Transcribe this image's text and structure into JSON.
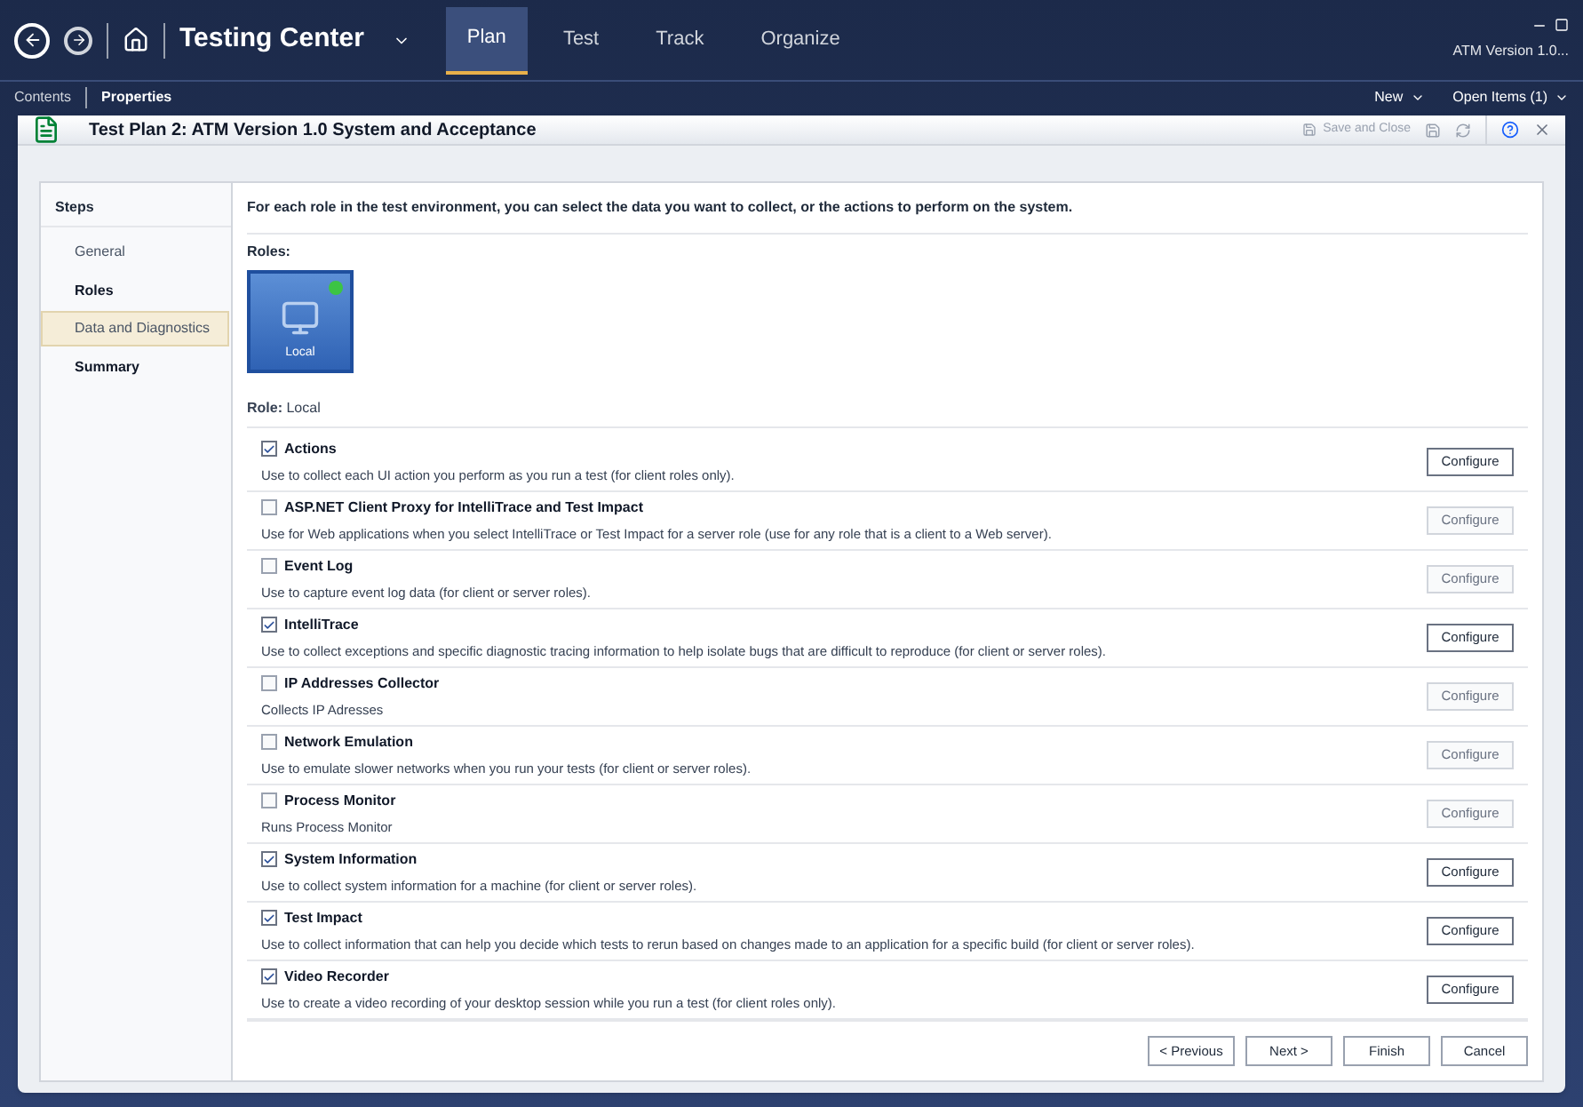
{
  "top_bar": {
    "app_title": "Testing Center",
    "tabs": [
      {
        "label": "Plan",
        "selected": true
      },
      {
        "label": "Test",
        "selected": false
      },
      {
        "label": "Track",
        "selected": false
      },
      {
        "label": "Organize",
        "selected": false
      }
    ],
    "project": "ATM Version 1.0..."
  },
  "sub_bar": {
    "tabs": [
      {
        "label": "Contents",
        "selected": false
      },
      {
        "label": "Properties",
        "selected": true
      }
    ],
    "right_menus": [
      "New",
      "Open Items (1)"
    ]
  },
  "window": {
    "title": "Test Plan 2: ATM Version 1.0 System and Acceptance",
    "save_and_close": {
      "label": "Save and Close",
      "disabled": true
    }
  },
  "steps": {
    "heading": "Steps",
    "items": [
      {
        "label": "General",
        "selected": false,
        "emphasized": false
      },
      {
        "label": "Roles",
        "selected": false,
        "emphasized": true
      },
      {
        "label": "Data and Diagnostics",
        "selected": true,
        "emphasized": false
      },
      {
        "label": "Summary",
        "selected": false,
        "emphasized": true
      }
    ]
  },
  "intro": "For each role in the test environment, you can select the data you want to collect, or the actions to perform on the system.",
  "roles": {
    "heading": "Roles:",
    "items": [
      {
        "label": "Local",
        "selected": true
      }
    ]
  },
  "role": {
    "label": "Role:",
    "value": "Local"
  },
  "adapters": [
    {
      "name": "Actions",
      "description": "Use to collect each UI action you perform as you run a test (for client roles only).",
      "checked": true,
      "button": "Configure",
      "disabled": false
    },
    {
      "name": "ASP.NET Client Proxy for IntelliTrace and Test Impact",
      "description": "Use for Web applications when you select IntelliTrace or Test Impact for a server role (use for any role that is a client to a Web server).",
      "checked": false,
      "button": "Configure",
      "disabled": true
    },
    {
      "name": "Event Log",
      "description": "Use to capture event log data (for client or server roles).",
      "checked": false,
      "button": "Configure",
      "disabled": true
    },
    {
      "name": "IntelliTrace",
      "description": "Use to collect exceptions and specific diagnostic tracing information to help isolate bugs that are difficult to reproduce (for client or server roles).",
      "checked": true,
      "button": "Configure",
      "disabled": false
    },
    {
      "name": "IP Addresses Collector",
      "description": "Collects IP Adresses",
      "checked": false,
      "button": "Configure",
      "disabled": true
    },
    {
      "name": "Network Emulation",
      "description": "Use to emulate slower networks when you run your tests (for client or server roles).",
      "checked": false,
      "button": "Configure",
      "disabled": true
    },
    {
      "name": "Process Monitor",
      "description": "Runs Process Monitor",
      "checked": false,
      "button": "Configure",
      "disabled": true
    },
    {
      "name": "System Information",
      "description": "Use to collect system information for a machine (for client or server roles).",
      "checked": true,
      "button": "Configure",
      "disabled": false
    },
    {
      "name": "Test Impact",
      "description": "Use to collect information that can help you decide which tests to rerun based on changes made to an application for a specific build (for client or server roles).",
      "checked": true,
      "button": "Configure",
      "disabled": false
    },
    {
      "name": "Video Recorder",
      "description": "Use to create a video recording of your desktop session while you run a test (for client roles only).",
      "checked": true,
      "button": "Configure",
      "disabled": false
    }
  ],
  "footer_buttons": [
    "< Previous",
    "Next >",
    "Finish",
    "Cancel"
  ]
}
